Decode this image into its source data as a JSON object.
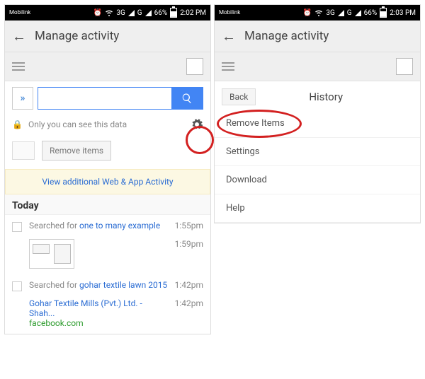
{
  "status": {
    "carrier": "Mobilink",
    "net1": "3G",
    "net2": "G",
    "battery_left": "66%",
    "time_left": "2:02 PM",
    "battery_right": "66%",
    "time_right": "2:03 PM"
  },
  "appbar": {
    "title": "Manage activity"
  },
  "search": {
    "value": "",
    "placeholder": ""
  },
  "privacy": {
    "text": "Only you can see this data"
  },
  "actions": {
    "remove_items": "Remove items"
  },
  "promo": {
    "text": "View additional Web & App Activity"
  },
  "sections": {
    "today": {
      "label": "Today",
      "items": [
        {
          "prefix": "Searched for ",
          "query": "one to many example",
          "time": "1:55pm"
        },
        {
          "thumb_time": "1:59pm"
        },
        {
          "prefix": "Searched for ",
          "query": "gohar textile lawn 2015",
          "time": "1:42pm"
        },
        {
          "title": "Gohar Textile Mills (Pvt.) Ltd. - Shah...",
          "site": "facebook.com",
          "time": "1:42pm"
        }
      ]
    }
  },
  "menu": {
    "back": "Back",
    "title": "History",
    "items": [
      "Remove Items",
      "Settings",
      "Download",
      "Help"
    ]
  }
}
